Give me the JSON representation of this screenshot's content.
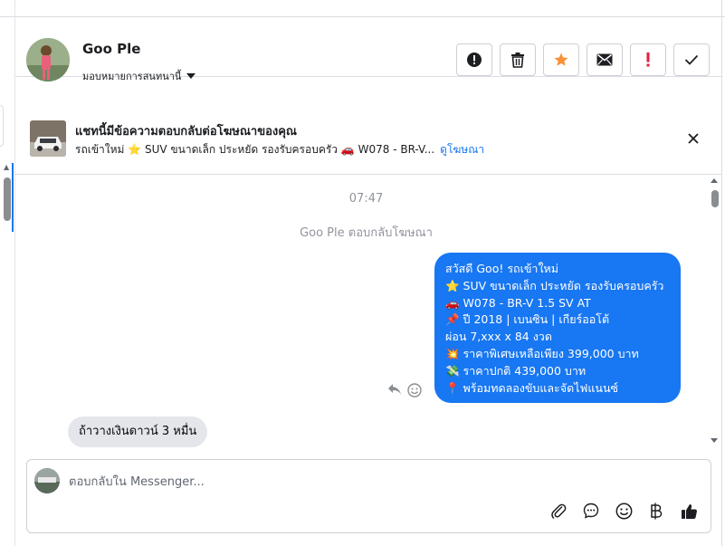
{
  "header": {
    "contact_name": "Goo Ple",
    "assign_label": "มอบหมายการสนทนานี้",
    "actions": [
      {
        "name": "spam-button",
        "icon": "alert-circle-icon"
      },
      {
        "name": "delete-button",
        "icon": "trash-icon"
      },
      {
        "name": "star-button",
        "icon": "star-icon"
      },
      {
        "name": "mark-unread-button",
        "icon": "envelope-icon"
      },
      {
        "name": "follow-up-button",
        "icon": "exclamation-icon"
      },
      {
        "name": "mark-done-button",
        "icon": "check-icon"
      }
    ]
  },
  "ad_banner": {
    "title": "แชทนี้มีข้อความตอบกลับต่อโฆษณาของคุณ",
    "subtitle": "รถเข้าใหม่ ⭐ SUV ขนาดเล็ก ประหยัด รองรับครอบครัว 🚗 W078 - BR-V...",
    "link": "ดูโฆษณา"
  },
  "thread": {
    "time": "07:47",
    "replied_note": "Goo Ple ตอบกลับโฆษณา",
    "outgoing_lines": [
      "สวัสดี Goo! รถเข้าใหม่",
      "⭐ SUV ขนาดเล็ก ประหยัด รองรับครอบครัว",
      "🚗 W078 - BR-V 1.5 SV AT",
      "📌 ปี 2018 | เบนซิน | เกียร์ออโต้",
      "ผ่อน 7,xxx x 84 งวด",
      "💥 ราคาพิเศษเหลือเพียง 399,000 บาท",
      "💸 ราคาปกติ 439,000 บาท",
      "📍 พร้อมทดลองขับและจัดไฟแนนซ์"
    ],
    "incoming_message": "ถ้าวางเงินดาวน์ 3 หมื่น"
  },
  "composer": {
    "placeholder": "ตอบกลับใน Messenger...",
    "tools": [
      "paperclip-icon",
      "chat-bubble-icon",
      "emoji-icon",
      "baht-icon",
      "thumbs-up-icon"
    ]
  },
  "colors": {
    "accent": "#1877f2",
    "star": "#f7923b",
    "follow_up": "#e41e3f",
    "incoming_bubble": "#e4e6eb"
  }
}
